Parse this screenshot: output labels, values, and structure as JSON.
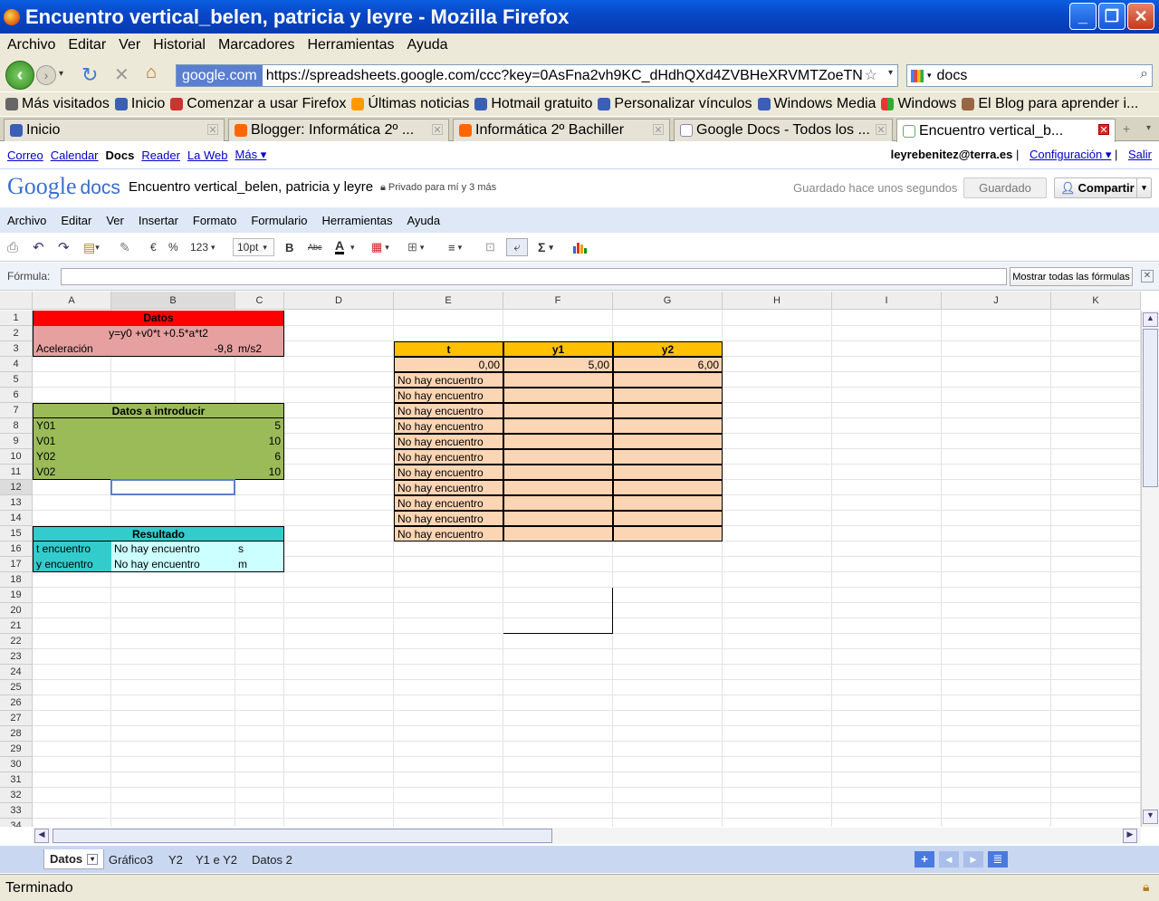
{
  "window": {
    "title": "Encuentro vertical_belen, patricia y leyre - Mozilla Firefox"
  },
  "browser_menu": [
    "Archivo",
    "Editar",
    "Ver",
    "Historial",
    "Marcadores",
    "Herramientas",
    "Ayuda"
  ],
  "nav": {
    "site_badge": "google.com",
    "url": "https://spreadsheets.google.com/ccc?key=0AsFna2vh9KC_dHdhQXd4ZVBHeXRVMTZoeTN",
    "search_value": "docs"
  },
  "bookmarks": [
    "Más visitados",
    "Inicio",
    "Comenzar a usar Firefox",
    "Últimas noticias",
    "Hotmail gratuito",
    "Personalizar vínculos",
    "Windows Media",
    "Windows",
    "El Blog para aprender i..."
  ],
  "tabs": [
    "Inicio",
    "Blogger: Informática 2º ...",
    "Informática 2º Bachiller",
    "Google Docs - Todos los ...",
    "Encuentro vertical_b..."
  ],
  "gbar": {
    "links": [
      "Correo",
      "Calendar",
      "Docs",
      "Reader",
      "La Web",
      "Más ▾"
    ],
    "user": "leyrebenitez@terra.es",
    "config": "Configuración ▾",
    "signout": "Salir"
  },
  "doc": {
    "logo_google": "Google",
    "logo_docs": "docs",
    "title": "Encuentro vertical_belen, patricia y leyre",
    "privacy": "Privado para mí y 3 más",
    "saved_status": "Guardado hace unos segundos",
    "saved_button": "Guardado",
    "share_button": "Compartir"
  },
  "app_menu": [
    "Archivo",
    "Editar",
    "Ver",
    "Insertar",
    "Formato",
    "Formulario",
    "Herramientas",
    "Ayuda"
  ],
  "toolbar": {
    "euro": "€",
    "percent": "%",
    "number_format": "123",
    "font_size": "10pt",
    "bold": "B",
    "strike": "Abc",
    "font_color": "A",
    "sigma": "Σ"
  },
  "formula": {
    "label": "Fórmula:",
    "value": "",
    "show_all": "Mostrar todas las fórmulas"
  },
  "columns": [
    "A",
    "B",
    "C",
    "D",
    "E",
    "F",
    "G",
    "H",
    "I",
    "J",
    "K"
  ],
  "rows": [
    "1",
    "2",
    "3",
    "4",
    "5",
    "6",
    "7",
    "8",
    "9",
    "10",
    "11",
    "12",
    "13",
    "14",
    "15",
    "16",
    "17",
    "18",
    "19",
    "20",
    "21",
    "22",
    "23",
    "24",
    "25",
    "26",
    "27",
    "28",
    "29",
    "30",
    "31",
    "32",
    "33",
    "34"
  ],
  "cells": {
    "A1": "Datos",
    "A2": "y=y0 +v0*t +0.5*a*t2",
    "A3": "Aceleración",
    "B3": "-9,8",
    "C3": "m/s2",
    "A7": "Datos a introducir",
    "A8": "Y01",
    "B8": "5",
    "A9": "V01",
    "B9": "10",
    "A10": "Y02",
    "B10": "6",
    "A11": "V02",
    "B11": "10",
    "A15": "Resultado",
    "A16": "t encuentro",
    "B16": "No hay encuentro",
    "C16": "s",
    "A17": "y encuentro",
    "B17": "No hay encuentro",
    "C17": "m",
    "E3": "t",
    "F3": "y1",
    "G3": "y2",
    "E4": "0,00",
    "F4": "5,00",
    "G4": "6,00",
    "E_no": "No hay encuentro"
  },
  "sheet_tabs": [
    "Datos",
    "Gráfico3",
    "Y2",
    "Y1 e Y2",
    "Datos 2"
  ],
  "status": "Terminado",
  "colors": {
    "red": "#ff0000",
    "pink": "#e6a0a0",
    "green": "#9bbb59",
    "cyan": "#33cccc",
    "lightcyan": "#ccffff",
    "orange": "#ffc000",
    "peach": "#fcd5b4"
  }
}
